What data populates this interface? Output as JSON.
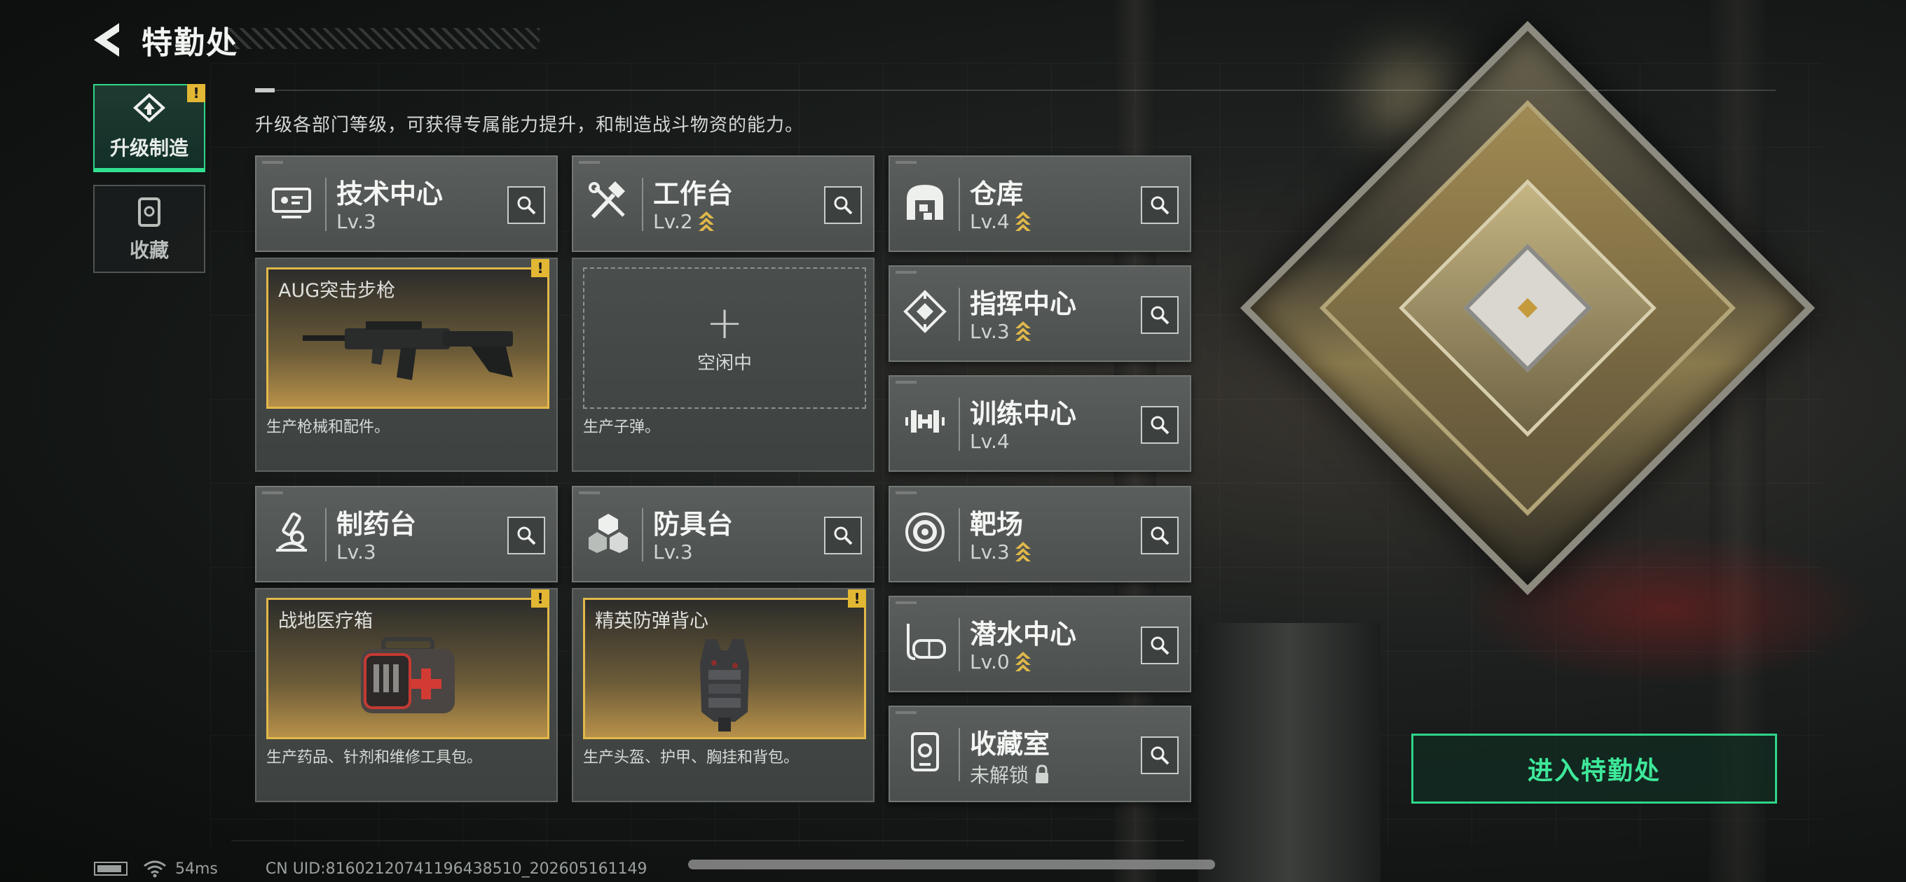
{
  "header": {
    "title": "特勤处",
    "back_icon": "back-arrow-icon"
  },
  "sidebar": {
    "tabs": [
      {
        "label": "升级制造",
        "icon": "upgrade-craft-icon",
        "active": true,
        "alert": "!"
      },
      {
        "label": "收藏",
        "icon": "collection-icon",
        "active": false
      }
    ]
  },
  "main": {
    "subtitle": "升级各部门等级，可获得专属能力提升，和制造战斗物资的能力。",
    "columns": [
      {
        "name": "技术中心",
        "level": "Lv.3",
        "upgradable": false,
        "icon": "tech-center-icon",
        "production": {
          "item": "AUG突击步枪",
          "state": "producing",
          "alert": "!",
          "desc": "生产枪械和配件。"
        }
      },
      {
        "name": "工作台",
        "level": "Lv.2",
        "upgradable": true,
        "icon": "workbench-icon",
        "production": {
          "state": "idle",
          "idle_label": "空闲中",
          "plus": "+",
          "desc": "生产子弹。"
        }
      },
      {
        "name": "制药台",
        "level": "Lv.3",
        "upgradable": false,
        "icon": "pharmacy-icon",
        "production": {
          "item": "战地医疗箱",
          "state": "producing",
          "alert": "!",
          "desc": "生产药品、针剂和维修工具包。"
        }
      },
      {
        "name": "防具台",
        "level": "Lv.3",
        "upgradable": false,
        "icon": "armor-bench-icon",
        "production": {
          "item": "精英防弹背心",
          "state": "producing",
          "alert": "!",
          "desc": "生产头盔、护甲、胸挂和背包。"
        }
      }
    ],
    "facilities": [
      {
        "name": "仓库",
        "level": "Lv.4",
        "upgradable": true,
        "icon": "warehouse-icon"
      },
      {
        "name": "指挥中心",
        "level": "Lv.3",
        "upgradable": true,
        "icon": "command-center-icon"
      },
      {
        "name": "训练中心",
        "level": "Lv.4",
        "upgradable": false,
        "icon": "training-center-icon"
      },
      {
        "name": "靶场",
        "level": "Lv.3",
        "upgradable": true,
        "icon": "shooting-range-icon"
      },
      {
        "name": "潜水中心",
        "level": "Lv.0",
        "upgradable": true,
        "icon": "diving-center-icon"
      },
      {
        "name": "收藏室",
        "level": "未解锁",
        "locked": true,
        "icon": "collection-room-icon"
      }
    ],
    "enter_button": "进入特勤处"
  },
  "status": {
    "ping": "54ms",
    "uid": "CN UID:8160212074119643851​0_202605161149"
  },
  "colors": {
    "accent_green": "#31e08f",
    "alert_yellow": "#e2b733",
    "upgrade_gold": "#e0b84a"
  }
}
